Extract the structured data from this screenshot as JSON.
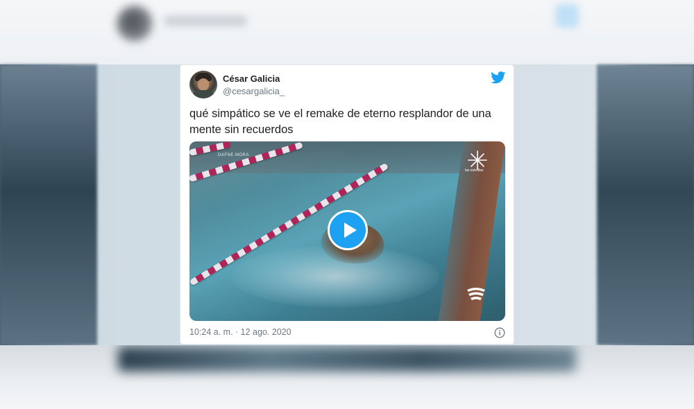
{
  "tweet": {
    "display_name": "César Galicia",
    "handle": "@cesargalicia_",
    "text": "qué simpático se ve el remake de eterno resplandor de una mente sin recuerdos",
    "timestamp": "10:24 a. m. · 12 ago. 2020"
  },
  "video": {
    "watermark_name": "DAFNE MORA",
    "channel_label": "las estrellas"
  },
  "icons": {
    "brand": "twitter-bird-icon",
    "play": "play-icon",
    "info": "info-icon"
  },
  "colors": {
    "accent": "#1da1f2",
    "text_primary": "#1c2022",
    "text_secondary": "#697882",
    "card_border": "#e1e8ed"
  }
}
